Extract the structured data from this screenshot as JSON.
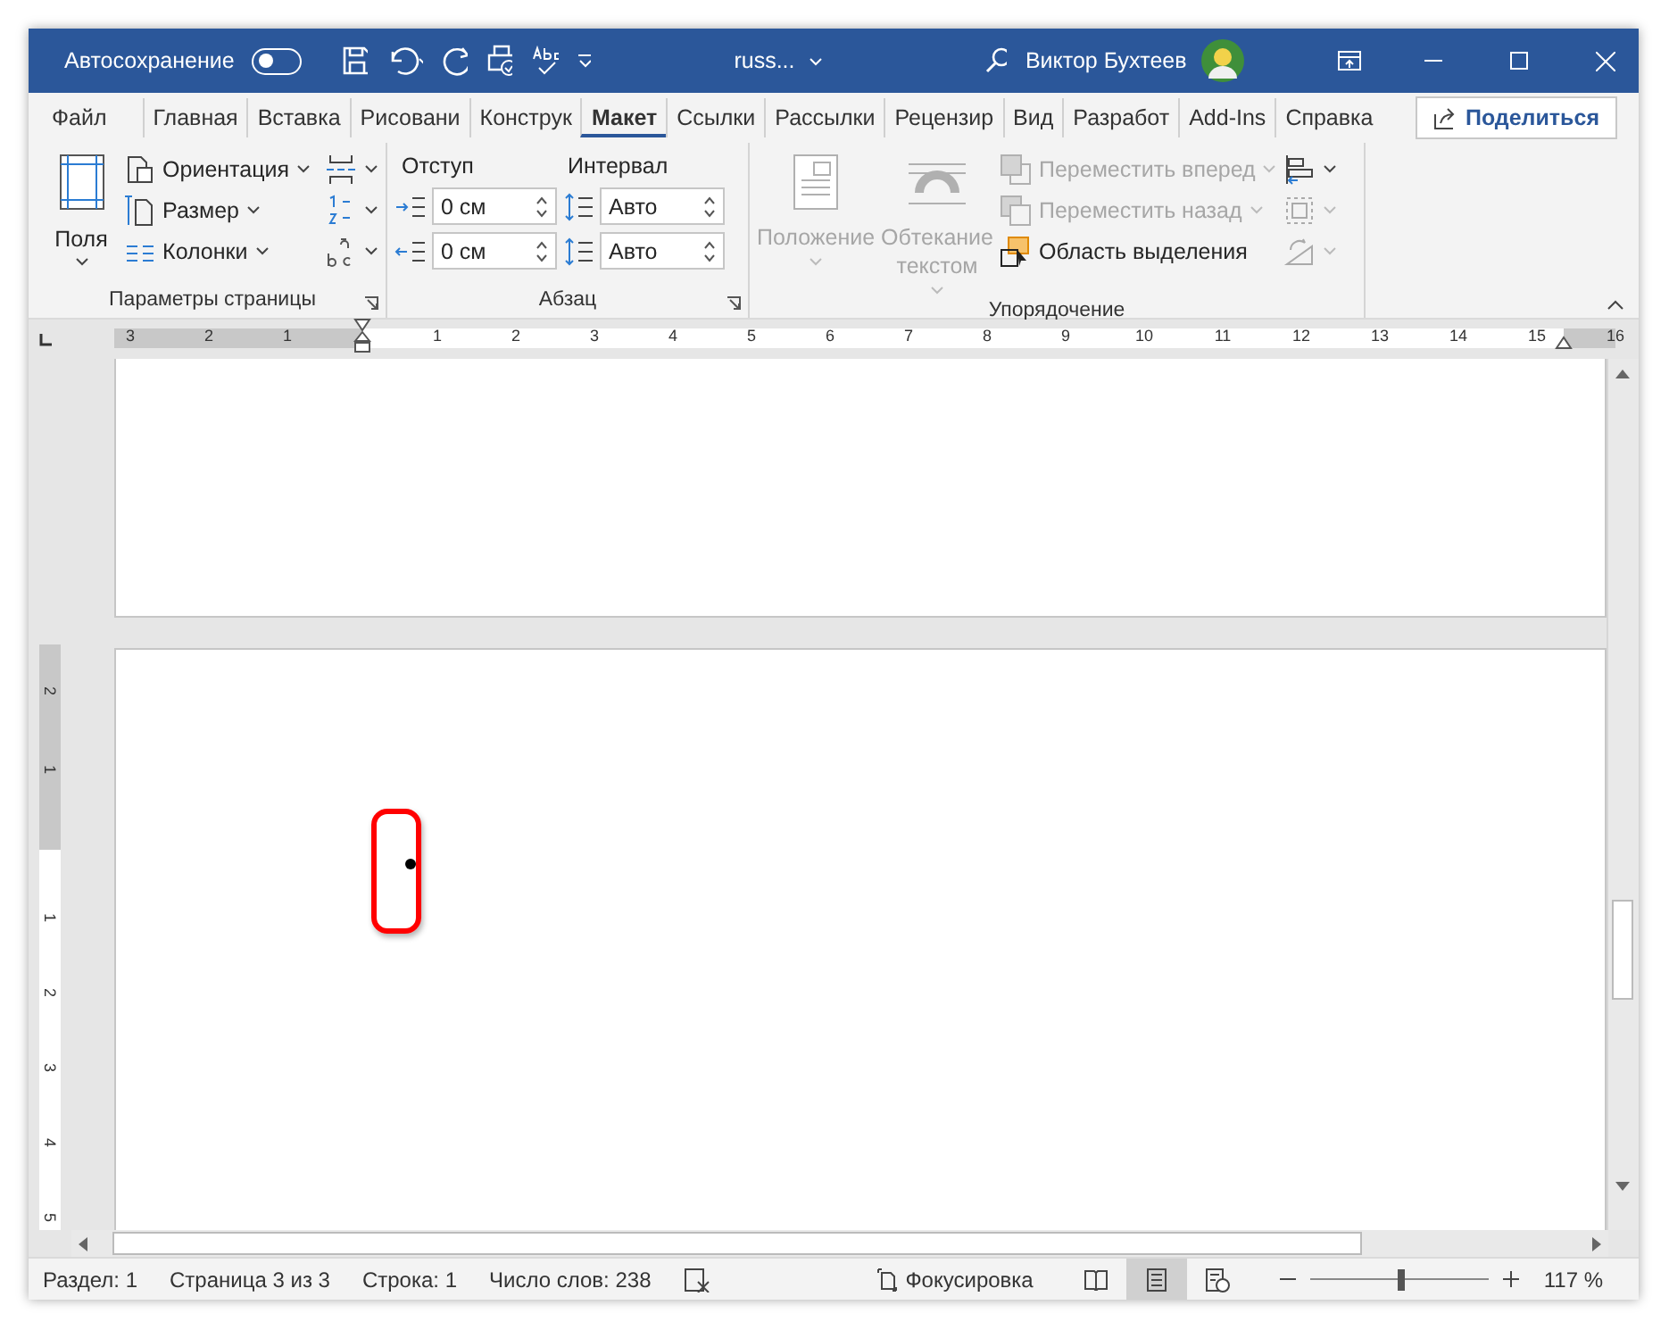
{
  "window": {
    "autosave_label": "Автосохранение",
    "autosave_on": false,
    "filename": "russ...",
    "user": "Виктор Бухтеев"
  },
  "tabs": [
    {
      "label": "Файл",
      "selected": false
    },
    {
      "label": "Главная",
      "selected": false
    },
    {
      "label": "Вставка",
      "selected": false
    },
    {
      "label": "Рисовани",
      "selected": false
    },
    {
      "label": "Конструк",
      "selected": false
    },
    {
      "label": "Макет",
      "selected": true
    },
    {
      "label": "Ссылки",
      "selected": false
    },
    {
      "label": "Рассылки",
      "selected": false
    },
    {
      "label": "Рецензир",
      "selected": false
    },
    {
      "label": "Вид",
      "selected": false
    },
    {
      "label": "Разработ",
      "selected": false
    },
    {
      "label": "Add-Ins",
      "selected": false
    },
    {
      "label": "Справка",
      "selected": false
    }
  ],
  "share_button": "Поделиться",
  "page_setup": {
    "title": "Параметры страницы",
    "margins": "Поля",
    "items": [
      {
        "kind": "orientation",
        "label": "Ориентация"
      },
      {
        "kind": "size",
        "label": "Размер"
      },
      {
        "kind": "columns",
        "label": "Колонки"
      }
    ]
  },
  "paragraph": {
    "title": "Абзац",
    "indent_label": "Отступ",
    "spacing_label": "Интервал",
    "rows": [
      {
        "indent": "0 см",
        "spacing": "Авто"
      },
      {
        "indent": "0 см",
        "spacing": "Авто"
      }
    ]
  },
  "arrange": {
    "title": "Упорядочение",
    "large": [
      {
        "kind": "position",
        "label": "Положение",
        "disabled": true
      },
      {
        "kind": "wrap",
        "label": "Обтекание текстом",
        "disabled": true
      }
    ],
    "small": [
      {
        "kind": "forward",
        "label": "Переместить вперед",
        "disabled": true
      },
      {
        "kind": "backward",
        "label": "Переместить назад",
        "disabled": true
      },
      {
        "kind": "selection",
        "label": "Область выделения",
        "disabled": false
      }
    ]
  },
  "ruler": {
    "before": [
      "3",
      "2",
      "1"
    ],
    "after": [
      "1",
      "2",
      "3",
      "4",
      "5",
      "6",
      "7",
      "8",
      "9",
      "10",
      "11",
      "12",
      "13",
      "14",
      "15",
      "16"
    ]
  },
  "vertical_ruler": {
    "before": [
      "2",
      "1"
    ],
    "after": [
      "1",
      "2",
      "3",
      "4",
      "5"
    ]
  },
  "status_bar": {
    "items": [
      "Раздел: 1",
      "Страница 3 из 3",
      "Строка: 1",
      "Число слов: 238"
    ],
    "focus": "Фокусировка",
    "views": [
      {
        "kind": "read",
        "selected": false
      },
      {
        "kind": "print",
        "selected": true
      },
      {
        "kind": "web",
        "selected": false
      }
    ],
    "zoom": {
      "level": 0.51,
      "reading": "117 %"
    }
  }
}
